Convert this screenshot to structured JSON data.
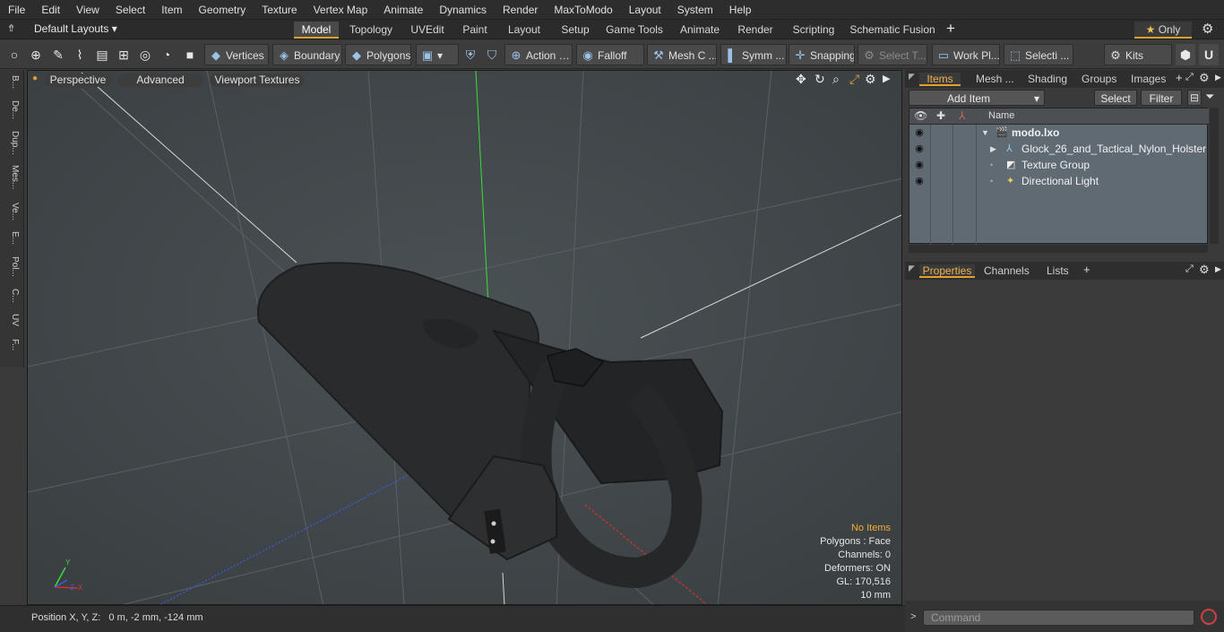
{
  "menu": [
    "File",
    "Edit",
    "View",
    "Select",
    "Item",
    "Geometry",
    "Texture",
    "Vertex Map",
    "Animate",
    "Dynamics",
    "Render",
    "MaxToModo",
    "Layout",
    "System",
    "Help"
  ],
  "layoutbar": {
    "layout_select": "Default Layouts",
    "tabs": [
      "Model",
      "Topology",
      "UVEdit",
      "Paint",
      "Layout",
      "Setup",
      "Game Tools",
      "Animate",
      "Render",
      "Scripting",
      "Schematic Fusion"
    ],
    "active_tab": "Model",
    "only_label": "Only"
  },
  "toolbar": {
    "vertices": "Vertices",
    "boundary": "Boundary",
    "polygons": "Polygons",
    "action": "Action",
    "falloff": "Falloff",
    "mesh": "Mesh C ...",
    "symm": "Symm ...",
    "snapping": "Snapping",
    "select_t": "Select T...",
    "work_pl": "Work Pl...",
    "selecti": "Selecti ...",
    "kits": "Kits"
  },
  "left_tabs": [
    "B...",
    "De...",
    "Dup...",
    "Mes...",
    "Ve...",
    "E...",
    "Pol...",
    "C...",
    "UV",
    "F..."
  ],
  "viewport": {
    "perspective": "Perspective",
    "advanced": "Advanced",
    "viewport_textures": "Viewport Textures",
    "stats": {
      "no_items": "No Items",
      "polygons": "Polygons : Face",
      "channels": "Channels: 0",
      "deformers": "Deformers: ON",
      "gl": "GL: 170,516",
      "unit": "10 mm"
    },
    "axis_labels": {
      "y": "Y",
      "x": "X",
      "z": "Z"
    }
  },
  "status": {
    "position": "Position X, Y, Z:   0 m, -2 mm, -124 mm"
  },
  "items_panel": {
    "tabs": [
      "Items",
      "Mesh ...",
      "Shading",
      "Groups",
      "Images"
    ],
    "active_tab": "Items",
    "add_item": "Add Item",
    "select": "Select",
    "filter": "Filter",
    "name_header": "Name",
    "rows": [
      {
        "label": "modo.lxo"
      },
      {
        "label": "Glock_26_and_Tactical_Nylon_Holster"
      },
      {
        "label": "Texture Group"
      },
      {
        "label": "Directional Light"
      }
    ]
  },
  "properties_panel": {
    "tabs": [
      "Properties",
      "Channels",
      "Lists"
    ],
    "active_tab": "Properties"
  },
  "command": {
    "placeholder": "Command"
  },
  "colors": {
    "accent": "#e0a030",
    "y_axis": "#38d838",
    "x_axis": "#d83030",
    "z_axis": "#3050e0"
  }
}
